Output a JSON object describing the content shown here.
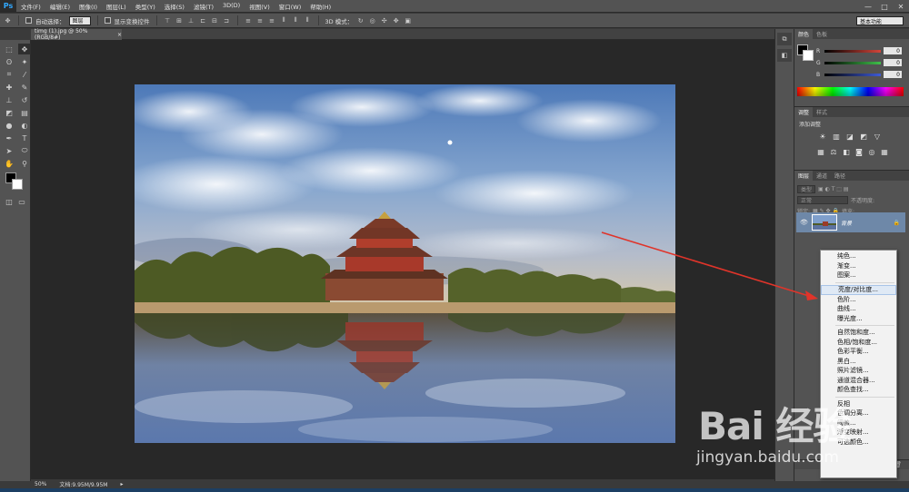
{
  "app": {
    "logo": "Ps"
  },
  "menu": [
    "文件(F)",
    "编辑(E)",
    "图像(I)",
    "图层(L)",
    "类型(Y)",
    "选择(S)",
    "滤镜(T)",
    "3D(D)",
    "视图(V)",
    "窗口(W)",
    "帮助(H)"
  ],
  "window_controls": {
    "minimize": "—",
    "maximize": "□",
    "close": "✕"
  },
  "options": {
    "auto_select_label": "自动选择：",
    "auto_select_value": "图层",
    "show_transform_label": "显示变换控件",
    "mode_3d_label": "3D 模式：",
    "workspace": "基本功能"
  },
  "document": {
    "tab_title": "timg (1).jpg @ 50%(RGB/8#)",
    "tab_close": "×"
  },
  "status": {
    "zoom": "50%",
    "doc_info": "文档:9.95M/9.95M"
  },
  "color_panel": {
    "tabs": [
      "颜色",
      "色板"
    ],
    "sliders": [
      {
        "label": "R",
        "value": "0",
        "color": "#d4453a"
      },
      {
        "label": "G",
        "value": "0",
        "color": "#3fbf4a"
      },
      {
        "label": "B",
        "value": "0",
        "color": "#3f5bd6"
      }
    ]
  },
  "adjustments_panel": {
    "tabs": [
      "调整",
      "样式"
    ],
    "title": "添加调整"
  },
  "layers_panel": {
    "tabs": [
      "图层",
      "通道",
      "路径"
    ],
    "kind_label": "类型",
    "blend_mode": "正常",
    "opacity_label": "不透明度:",
    "lock_label": "锁定:",
    "fill_label": "填充:",
    "layer_name": "背景"
  },
  "dropdown": {
    "groups": [
      [
        "纯色...",
        "渐变...",
        "图案..."
      ],
      [
        "亮度/对比度...",
        "色阶...",
        "曲线...",
        "曝光度..."
      ],
      [
        "自然饱和度...",
        "色相/饱和度...",
        "色彩平衡...",
        "黑白...",
        "照片滤镜...",
        "通道混合器...",
        "颜色查找..."
      ],
      [
        "反相",
        "色调分离...",
        "阈值...",
        "渐变映射...",
        "可选颜色..."
      ]
    ],
    "highlighted": "亮度/对比度..."
  },
  "watermark": {
    "brand": "Bai 经验",
    "url": "jingyan.baidu.com"
  },
  "accent": {
    "arrow": "#e0342a",
    "layer_selected": "#6e88a8"
  }
}
